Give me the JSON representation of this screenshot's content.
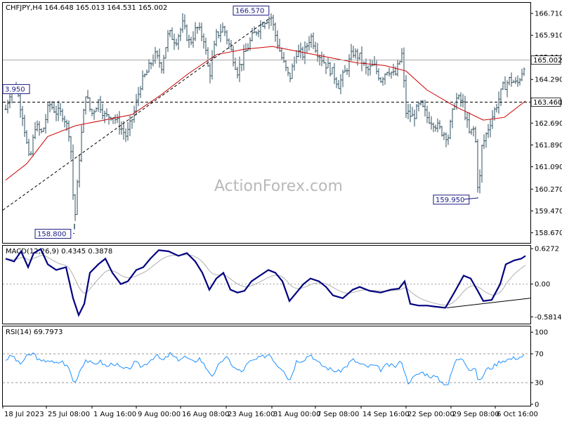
{
  "chart_data": [
    {
      "type": "candlestick",
      "header": "CHFJPY,H4  164.648 165.013 164.531 165.002",
      "watermark": "ActionForex.com",
      "ylim": [
        158.3,
        167.1
      ],
      "y_ticks": [
        "166.710",
        "165.910",
        "165.110",
        "164.290",
        "163.460",
        "162.690",
        "161.890",
        "161.090",
        "160.270",
        "159.470",
        "158.670"
      ],
      "x_ticks": [
        "18 Jul 2023",
        "25 Jul 08:00",
        "1 Aug 16:00",
        "9 Aug 00:00",
        "16 Aug 08:00",
        "23 Aug 16:00",
        "31 Aug 00:00",
        "7 Sep 08:00",
        "14 Sep 16:00",
        "22 Sep 00:00",
        "29 Sep 08:00",
        "6 Oct 16:00"
      ],
      "price_path": [
        [
          0,
          163.2
        ],
        [
          8,
          164.0
        ],
        [
          16,
          163.9
        ],
        [
          24,
          163.0
        ],
        [
          34,
          161.2
        ],
        [
          42,
          162.6
        ],
        [
          52,
          162.3
        ],
        [
          62,
          163.4
        ],
        [
          72,
          163.1
        ],
        [
          82,
          163.0
        ],
        [
          92,
          162.2
        ],
        [
          98,
          159.0
        ],
        [
          106,
          161.8
        ],
        [
          114,
          163.8
        ],
        [
          122,
          163.0
        ],
        [
          132,
          163.5
        ],
        [
          142,
          162.9
        ],
        [
          152,
          163.0
        ],
        [
          162,
          162.6
        ],
        [
          172,
          162.2
        ],
        [
          182,
          163.0
        ],
        [
          192,
          164.1
        ],
        [
          202,
          164.6
        ],
        [
          212,
          165.2
        ],
        [
          222,
          164.8
        ],
        [
          232,
          166.0
        ],
        [
          242,
          165.7
        ],
        [
          252,
          166.3
        ],
        [
          262,
          165.6
        ],
        [
          272,
          166.2
        ],
        [
          282,
          165.8
        ],
        [
          290,
          164.4
        ],
        [
          300,
          165.9
        ],
        [
          310,
          166.2
        ],
        [
          320,
          165.4
        ],
        [
          330,
          164.6
        ],
        [
          340,
          165.2
        ],
        [
          350,
          165.8
        ],
        [
          360,
          166.2
        ],
        [
          370,
          166.5
        ],
        [
          378,
          166.57
        ],
        [
          386,
          165.7
        ],
        [
          394,
          165.0
        ],
        [
          404,
          164.3
        ],
        [
          414,
          165.3
        ],
        [
          424,
          165.2
        ],
        [
          434,
          165.9
        ],
        [
          444,
          165.3
        ],
        [
          454,
          164.9
        ],
        [
          464,
          164.6
        ],
        [
          474,
          164.1
        ],
        [
          484,
          164.6
        ],
        [
          494,
          165.3
        ],
        [
          504,
          165.1
        ],
        [
          514,
          164.6
        ],
        [
          524,
          164.8
        ],
        [
          534,
          164.3
        ],
        [
          544,
          164.7
        ],
        [
          554,
          164.4
        ],
        [
          564,
          165.2
        ],
        [
          570,
          163.1
        ],
        [
          580,
          162.9
        ],
        [
          590,
          163.4
        ],
        [
          600,
          162.9
        ],
        [
          610,
          162.7
        ],
        [
          620,
          162.4
        ],
        [
          630,
          162.2
        ],
        [
          640,
          163.6
        ],
        [
          650,
          163.5
        ],
        [
          660,
          162.3
        ],
        [
          668,
          162.5
        ],
        [
          673,
          159.95
        ],
        [
          678,
          161.8
        ],
        [
          688,
          162.6
        ],
        [
          698,
          163.3
        ],
        [
          708,
          164.0
        ],
        [
          718,
          164.3
        ],
        [
          728,
          164.1
        ],
        [
          734,
          164.5
        ],
        [
          740,
          165.0
        ]
      ],
      "ma_path": [
        [
          0,
          160.6
        ],
        [
          30,
          161.2
        ],
        [
          60,
          162.2
        ],
        [
          100,
          162.6
        ],
        [
          140,
          162.8
        ],
        [
          180,
          163.0
        ],
        [
          220,
          163.7
        ],
        [
          260,
          164.5
        ],
        [
          300,
          165.2
        ],
        [
          340,
          165.4
        ],
        [
          380,
          165.5
        ],
        [
          420,
          165.3
        ],
        [
          460,
          165.1
        ],
        [
          500,
          164.9
        ],
        [
          540,
          164.8
        ],
        [
          570,
          164.6
        ],
        [
          600,
          163.9
        ],
        [
          640,
          163.3
        ],
        [
          680,
          162.8
        ],
        [
          710,
          162.9
        ],
        [
          740,
          163.5
        ]
      ],
      "annotations": [
        {
          "label": "3.950",
          "price": 163.95
        },
        {
          "label": "166.570",
          "price": 166.57
        },
        {
          "label": "158.800",
          "price": 158.8
        },
        {
          "label": "159.950",
          "price": 159.95
        }
      ],
      "hline_price": 163.46,
      "hline_label": "163.460",
      "last_price_label": "165.002",
      "trendline": {
        "x1_price": 159.5,
        "x2_price": 166.5
      }
    },
    {
      "type": "line",
      "header": "MACD(12,26,9) 0.4345 0.3878",
      "ylim": [
        -0.7,
        0.68
      ],
      "y_ticks": [
        "0.6272",
        "0.00",
        "-0.5814"
      ],
      "macd_path": [
        [
          0,
          0.45
        ],
        [
          12,
          0.4
        ],
        [
          22,
          0.58
        ],
        [
          32,
          0.3
        ],
        [
          40,
          0.55
        ],
        [
          50,
          0.62
        ],
        [
          60,
          0.35
        ],
        [
          72,
          0.25
        ],
        [
          86,
          0.3
        ],
        [
          96,
          -0.25
        ],
        [
          104,
          -0.55
        ],
        [
          112,
          -0.35
        ],
        [
          120,
          0.2
        ],
        [
          132,
          0.35
        ],
        [
          142,
          0.45
        ],
        [
          152,
          0.2
        ],
        [
          164,
          0.0
        ],
        [
          174,
          0.05
        ],
        [
          186,
          0.25
        ],
        [
          196,
          0.3
        ],
        [
          206,
          0.45
        ],
        [
          218,
          0.6
        ],
        [
          232,
          0.58
        ],
        [
          246,
          0.5
        ],
        [
          258,
          0.55
        ],
        [
          270,
          0.4
        ],
        [
          280,
          0.2
        ],
        [
          290,
          -0.1
        ],
        [
          300,
          0.1
        ],
        [
          310,
          0.2
        ],
        [
          320,
          -0.1
        ],
        [
          330,
          -0.15
        ],
        [
          340,
          -0.12
        ],
        [
          350,
          0.05
        ],
        [
          362,
          0.15
        ],
        [
          374,
          0.25
        ],
        [
          384,
          0.2
        ],
        [
          394,
          0.05
        ],
        [
          404,
          -0.3
        ],
        [
          414,
          -0.15
        ],
        [
          424,
          0.0
        ],
        [
          434,
          0.1
        ],
        [
          446,
          0.05
        ],
        [
          456,
          -0.05
        ],
        [
          466,
          -0.2
        ],
        [
          480,
          -0.25
        ],
        [
          494,
          -0.1
        ],
        [
          504,
          -0.05
        ],
        [
          518,
          -0.12
        ],
        [
          534,
          -0.15
        ],
        [
          548,
          -0.1
        ],
        [
          560,
          -0.08
        ],
        [
          568,
          0.05
        ],
        [
          576,
          -0.35
        ],
        [
          588,
          -0.38
        ],
        [
          600,
          -0.38
        ],
        [
          612,
          -0.4
        ],
        [
          626,
          -0.42
        ],
        [
          640,
          -0.12
        ],
        [
          652,
          0.15
        ],
        [
          662,
          0.1
        ],
        [
          672,
          -0.12
        ],
        [
          680,
          -0.3
        ],
        [
          692,
          -0.28
        ],
        [
          704,
          0.0
        ],
        [
          712,
          0.35
        ],
        [
          724,
          0.42
        ],
        [
          734,
          0.45
        ],
        [
          740,
          0.5
        ]
      ],
      "trendline": {
        "from": [
          636,
          -0.42
        ],
        "to": [
          755,
          -0.25
        ]
      }
    },
    {
      "type": "line",
      "header": "RSI(14) 69.7973",
      "ylim": [
        -2,
        108
      ],
      "y_ticks": [
        "100",
        "70",
        "30",
        "0"
      ],
      "levels": [
        70,
        30
      ],
      "rsi_path": [
        [
          0,
          62
        ],
        [
          10,
          68
        ],
        [
          20,
          55
        ],
        [
          30,
          66
        ],
        [
          40,
          71
        ],
        [
          50,
          58
        ],
        [
          60,
          62
        ],
        [
          70,
          56
        ],
        [
          80,
          60
        ],
        [
          90,
          50
        ],
        [
          98,
          28
        ],
        [
          106,
          48
        ],
        [
          114,
          62
        ],
        [
          124,
          55
        ],
        [
          134,
          60
        ],
        [
          144,
          52
        ],
        [
          154,
          58
        ],
        [
          164,
          50
        ],
        [
          174,
          48
        ],
        [
          184,
          58
        ],
        [
          194,
          52
        ],
        [
          204,
          60
        ],
        [
          214,
          68
        ],
        [
          224,
          60
        ],
        [
          234,
          70
        ],
        [
          244,
          62
        ],
        [
          256,
          66
        ],
        [
          266,
          58
        ],
        [
          276,
          64
        ],
        [
          286,
          50
        ],
        [
          296,
          38
        ],
        [
          306,
          60
        ],
        [
          316,
          64
        ],
        [
          326,
          50
        ],
        [
          336,
          45
        ],
        [
          346,
          58
        ],
        [
          356,
          62
        ],
        [
          366,
          66
        ],
        [
          376,
          70
        ],
        [
          386,
          55
        ],
        [
          396,
          48
        ],
        [
          404,
          32
        ],
        [
          414,
          60
        ],
        [
          424,
          62
        ],
        [
          434,
          70
        ],
        [
          444,
          58
        ],
        [
          454,
          52
        ],
        [
          464,
          48
        ],
        [
          474,
          45
        ],
        [
          484,
          52
        ],
        [
          494,
          62
        ],
        [
          504,
          56
        ],
        [
          514,
          52
        ],
        [
          524,
          54
        ],
        [
          534,
          48
        ],
        [
          544,
          55
        ],
        [
          554,
          52
        ],
        [
          564,
          60
        ],
        [
          572,
          30
        ],
        [
          582,
          38
        ],
        [
          592,
          45
        ],
        [
          602,
          40
        ],
        [
          612,
          38
        ],
        [
          622,
          30
        ],
        [
          630,
          28
        ],
        [
          640,
          60
        ],
        [
          650,
          66
        ],
        [
          660,
          48
        ],
        [
          668,
          50
        ],
        [
          674,
          30
        ],
        [
          684,
          48
        ],
        [
          694,
          52
        ],
        [
          704,
          60
        ],
        [
          714,
          62
        ],
        [
          724,
          64
        ],
        [
          734,
          66
        ],
        [
          740,
          69
        ]
      ]
    }
  ]
}
